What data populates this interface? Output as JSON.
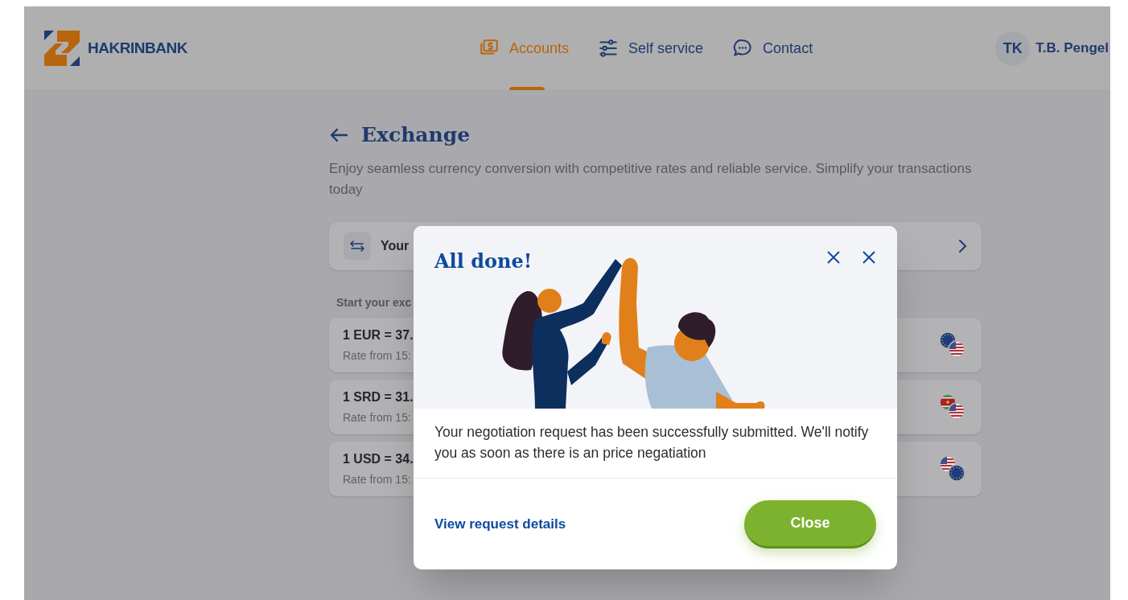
{
  "header": {
    "brand": "HAKRINBANK",
    "nav": [
      {
        "label": "Accounts",
        "selected": true
      },
      {
        "label": "Self service",
        "selected": false
      },
      {
        "label": "Contact",
        "selected": false
      }
    ],
    "user": {
      "initials": "TK",
      "name": "T.B. Pengel"
    }
  },
  "page": {
    "title": "Exchange",
    "description": "Enjoy seamless currency conversion with competitive rates and reliable service. Simplify your transactions today",
    "link": {
      "label": "Your"
    },
    "section_label": "Start your exc",
    "rates": [
      {
        "pair": "1 EUR = 37.",
        "time": "Rate from 15:",
        "kind": "eurusd"
      },
      {
        "pair": "1 SRD = 31.",
        "time": "Rate from 15:",
        "kind": "srdusd"
      },
      {
        "pair": "1 USD = 34.",
        "time": "Rate from 15:",
        "kind": "usdeur"
      }
    ]
  },
  "dialog": {
    "title": "All done!",
    "message": "Your negotiation request has been successfully submitted. We'll notify you as soon as there is an price negatiation",
    "link": "View request details",
    "button": "Close"
  }
}
